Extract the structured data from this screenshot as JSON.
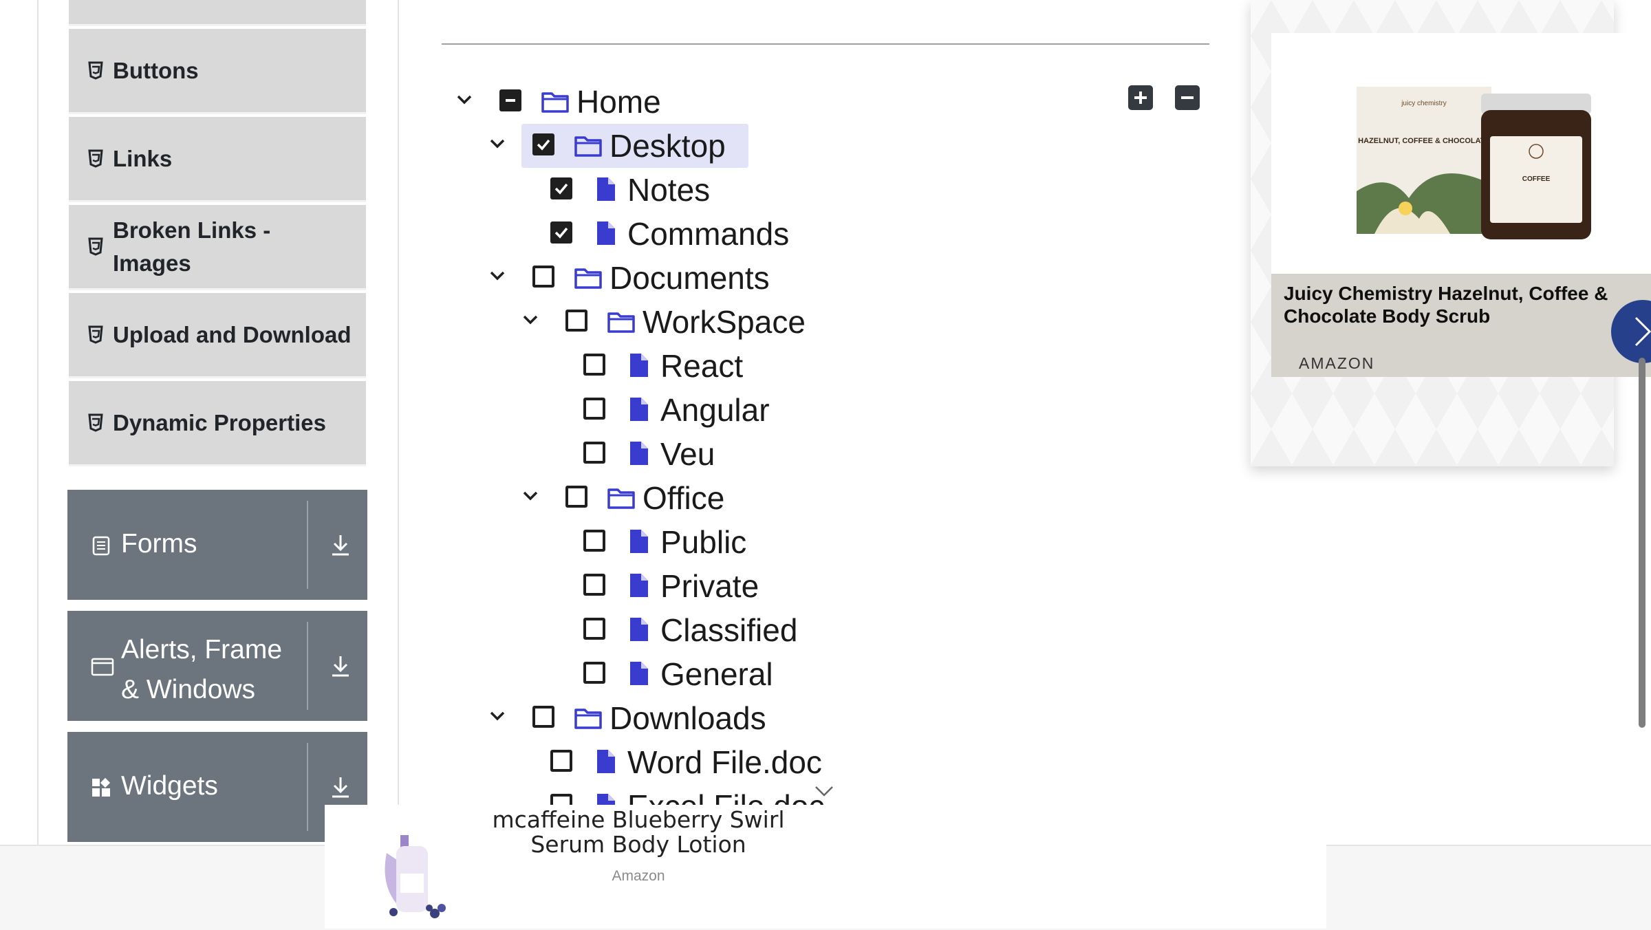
{
  "sidebar": {
    "items": [
      {
        "label": "Buttons"
      },
      {
        "label": "Links"
      },
      {
        "label": "Broken Links - Images"
      },
      {
        "label": "Upload and Download"
      },
      {
        "label": "Dynamic Properties"
      }
    ],
    "groups": [
      {
        "label": "Forms",
        "icon": "form-list-icon"
      },
      {
        "label": "Alerts, Frame & Windows",
        "icon": "browser-window-icon"
      },
      {
        "label": "Widgets",
        "icon": "widgets-grid-icon"
      }
    ]
  },
  "tree": {
    "nodes": {
      "home": "Home",
      "desktop": "Desktop",
      "notes": "Notes",
      "commands": "Commands",
      "documents": "Documents",
      "workspace": "WorkSpace",
      "react": "React",
      "angular": "Angular",
      "veu": "Veu",
      "office": "Office",
      "public": "Public",
      "private": "Private",
      "classified": "Classified",
      "general": "General",
      "downloads": "Downloads",
      "wordfile": "Word File.doc",
      "excelfile": "Excel File.doc"
    },
    "states": {
      "home": "indeterminate",
      "desktop": "checked",
      "notes": "checked",
      "commands": "checked"
    },
    "colors": {
      "file_icon": "#3a3ccf",
      "folder_icon": "#3a3ccf",
      "highlight": "#e2e3f7"
    }
  },
  "ad_right": {
    "title": "Juicy Chemistry Hazelnut, Coffee & Chocolate Body Scrub",
    "brand": "AMAZON",
    "product_label": "HAZELNUT, COFFEE & CHOCOLATE",
    "maker": "juicy chemistry"
  },
  "ad_bottom": {
    "title": "mcaffeine Blueberry Swirl Serum Body Lotion",
    "brand": "Amazon"
  }
}
